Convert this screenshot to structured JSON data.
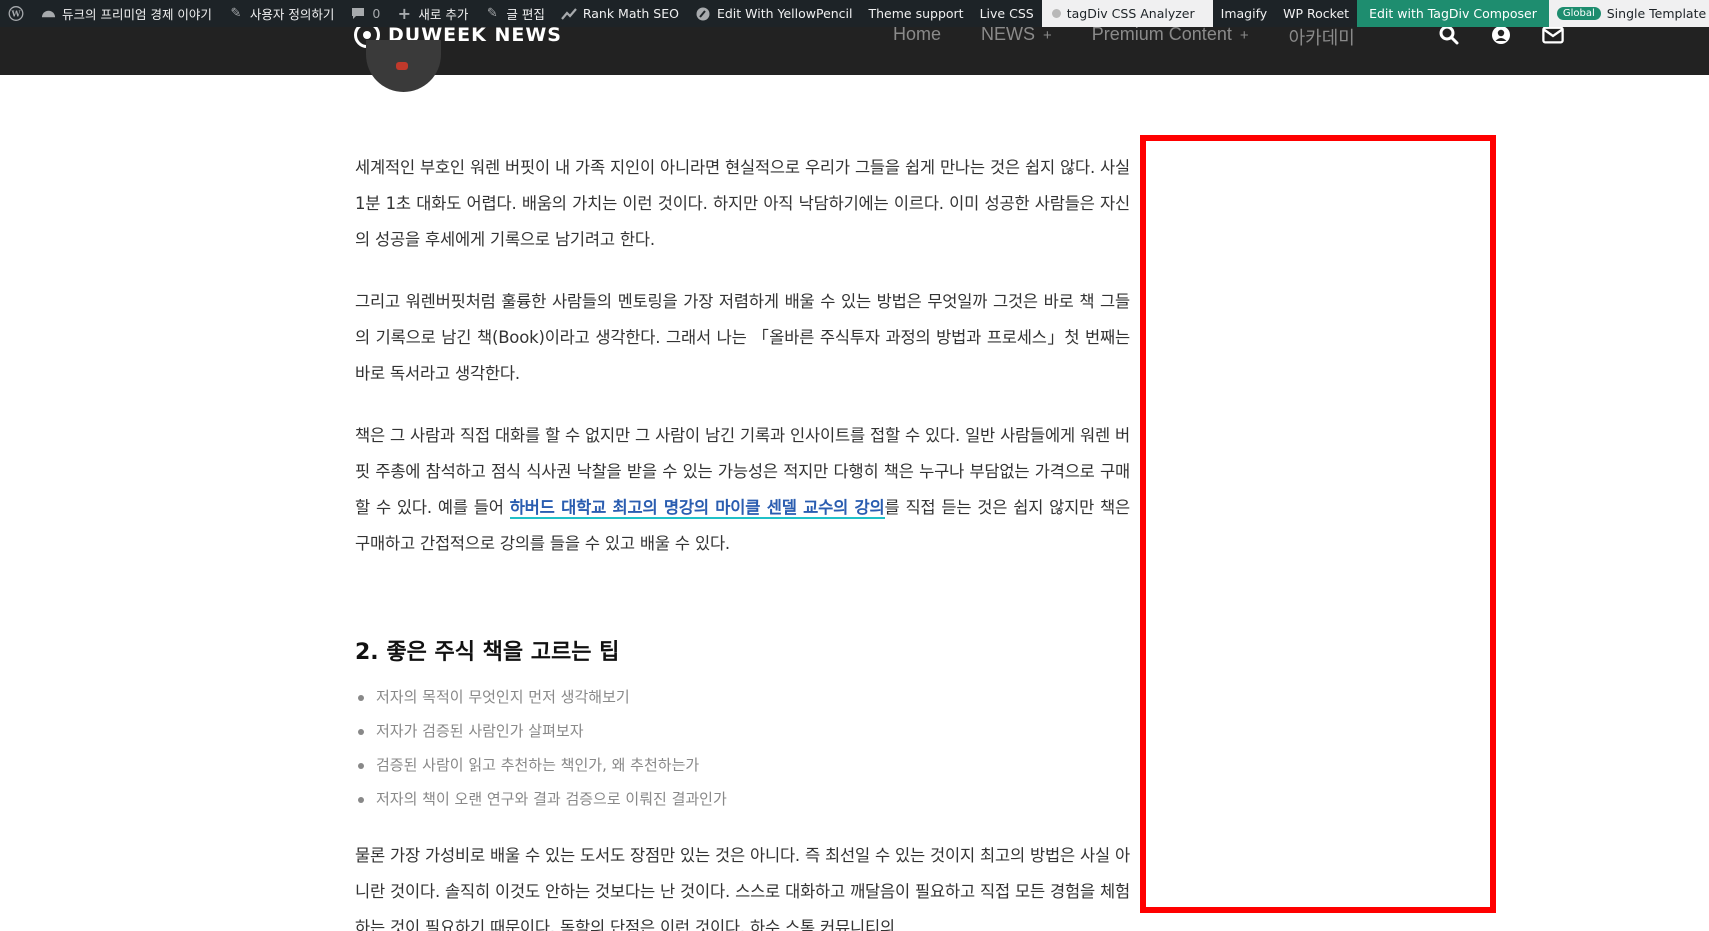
{
  "admin_bar": {
    "site_name": "듀크의 프리미엄 경제 이야기",
    "customize": "사용자 정의하기",
    "comments_count": "0",
    "new": "새로 추가",
    "edit_post": "글 편집",
    "rank_math": "Rank Math SEO",
    "yellowpencil": "Edit With YellowPencil",
    "theme_support": "Theme support",
    "live_css": "Live CSS",
    "css_analyzer": "tagDiv CSS Analyzer",
    "imagify": "Imagify",
    "wp_rocket": "WP Rocket",
    "composer": "Edit with TagDiv Composer",
    "global_badge": "Global",
    "single_template": "Single Template – Reel N"
  },
  "header": {
    "logo_text": "DUWEEK NEWS",
    "nav": [
      {
        "label": "Home",
        "plus": ""
      },
      {
        "label": "NEWS",
        "plus": "+"
      },
      {
        "label": "Premium Content",
        "plus": "+"
      },
      {
        "label": "아카데미",
        "plus": ""
      }
    ]
  },
  "article": {
    "paragraphs": [
      "세계적인 부호인 워렌 버핏이 내 가족 지인이 아니라면 현실적으로 우리가 그들을 쉽게 만나는 것은 쉽지 않다. 사실 1분 1초 대화도 어렵다. 배움의 가치는 이런 것이다. 하지만 아직 낙담하기에는 이르다. 이미 성공한 사람들은 자신의 성공을 후세에게 기록으로 남기려고 한다.",
      "그리고 워렌버핏처럼 훌륭한 사람들의 멘토링을 가장 저렴하게 배울 수 있는 방법은 무엇일까 그것은 바로 책 그들의 기록으로 남긴 책(Book)이라고 생각한다. 그래서 나는 「올바른 주식투자 과정의 방법과 프로세스」첫 번째는 바로 독서라고 생각한다."
    ],
    "para3_before": "책은 그 사람과 직접 대화를 할 수 없지만 그 사람이 남긴 기록과 인사이트를 접할 수 있다. 일반 사람들에게 워렌 버핏 주총에 참석하고 점식 식사권 낙찰을 받을 수 있는 가능성은 적지만 다행히 책은 누구나 부담없는 가격으로 구매할 수 있다. 예를 들어 ",
    "para3_link": "하버드 대학교 최고의 명강의 마이클 센델 교수의 강의",
    "para3_after": "를 직접 듣는 것은 쉽지 않지만 책은 구매하고 간접적으로 강의를 들을 수 있고 배울 수 있다.",
    "section_heading": "2. 좋은 주식 책을 고르는 팁",
    "tips": [
      "저자의 목적이 무엇인지 먼저 생각해보기",
      "저자가 검증된 사람인가 살펴보자",
      "검증된 사람이 읽고 추천하는 책인가, 왜 추천하는가",
      "저자의 책이 오랜 연구와 결과 검증으로 이뤄진 결과인가"
    ],
    "last_paragraph": "물론 가장 가성비로 배울 수 있는 도서도 장점만 있는 것은 아니다. 즉 최선일 수 있는 것이지 최고의 방법은 사실 아니란 것이다. 솔직히 이것도 안하는 것보다는 난 것이다. 스스로 대화하고 깨달음이 필요하고 직접 모든 경험을 체험하는 것이 필요하기 때문이다. 독학의 단점은 이런 것이다. 하수 스톡 커뮤니티의"
  },
  "colors": {
    "header_bg": "#222222",
    "admin_bg": "#1d2327",
    "annotation": "#ff0000",
    "link": "#2a5db0"
  }
}
